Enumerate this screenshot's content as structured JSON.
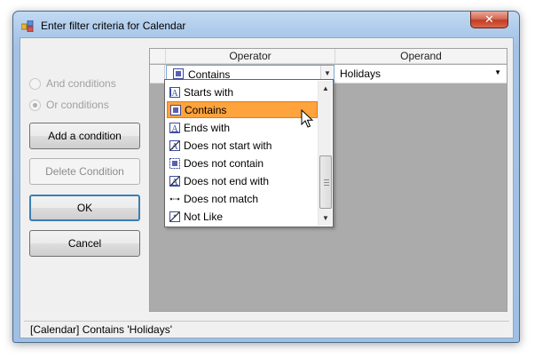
{
  "window": {
    "title": "Enter filter criteria for Calendar",
    "close_glyph": "✕"
  },
  "logic": {
    "and_label": "And conditions",
    "or_label": "Or conditions",
    "selected": "or"
  },
  "buttons": {
    "add_condition": "Add a condition",
    "delete_condition": "Delete Condition",
    "ok": "OK",
    "cancel": "Cancel"
  },
  "grid": {
    "headers": [
      "Operator",
      "Operand"
    ],
    "row": {
      "operator": "Contains",
      "operand": "Holidays"
    }
  },
  "operator_list": {
    "items": [
      {
        "label": "Starts with",
        "icon": "starts-with-icon"
      },
      {
        "label": "Contains",
        "icon": "contains-icon"
      },
      {
        "label": "Ends with",
        "icon": "ends-with-icon"
      },
      {
        "label": "Does not start with",
        "icon": "does-not-start-with-icon"
      },
      {
        "label": "Does not contain",
        "icon": "does-not-contain-icon"
      },
      {
        "label": "Does not end with",
        "icon": "does-not-end-with-icon"
      },
      {
        "label": "Does not match",
        "icon": "does-not-match-icon"
      },
      {
        "label": "Not Like",
        "icon": "not-like-icon"
      }
    ],
    "selected_index": 1
  },
  "status": {
    "text": "[Calendar] Contains 'Holidays'"
  },
  "colors": {
    "selection": "#ffa33c",
    "selection_border": "#e87c10",
    "close_button": "#c23d22"
  }
}
